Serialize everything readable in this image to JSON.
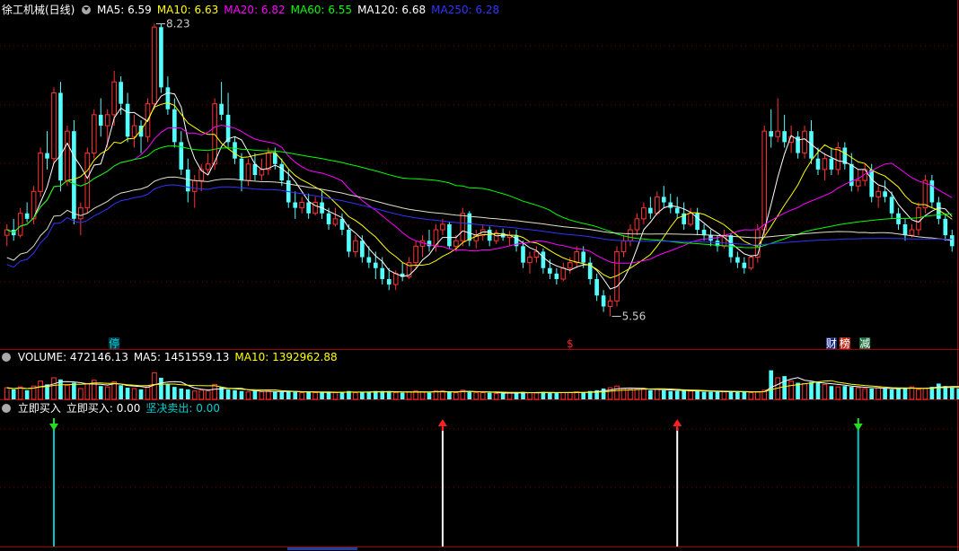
{
  "main_panel": {
    "title": "徐工机械(日线)",
    "ma_labels": [
      {
        "text": "MA5: 6.59",
        "color": "#ffffff"
      },
      {
        "text": "MA10: 6.63",
        "color": "#ffff00"
      },
      {
        "text": "MA20: 6.82",
        "color": "#ff00ff"
      },
      {
        "text": "MA60: 6.55",
        "color": "#00ff00"
      },
      {
        "text": "MA120: 6.68",
        "color": "#ffffff"
      },
      {
        "text": "MA250: 6.28",
        "color": "#3333ff"
      }
    ],
    "high_label": "8.23",
    "low_label": "5.56",
    "markers": [
      {
        "text": "停",
        "color": "#00d0d0",
        "bg": "#004050"
      },
      {
        "text": "$",
        "color": "#ff2020",
        "bg": "#000000"
      },
      {
        "text": "财",
        "color": "#ffffff",
        "bg": "#203080"
      },
      {
        "text": "榜",
        "color": "#ffffff",
        "bg": "#c03020"
      },
      {
        "text": "减",
        "color": "#ffffff",
        "bg": "#207040"
      }
    ]
  },
  "volume_panel": {
    "labels": [
      {
        "text": "VOLUME: 472146.13",
        "color": "#ffffff"
      },
      {
        "text": "MA5: 1451559.13",
        "color": "#ffffff"
      },
      {
        "text": "MA10: 1392962.88",
        "color": "#ffff00"
      }
    ]
  },
  "signal_panel": {
    "labels": [
      {
        "text": "立即买入",
        "color": "#ffffff"
      },
      {
        "text": "立即买入: 0.00",
        "color": "#ffffff"
      },
      {
        "text": "坚决卖出: 0.00",
        "color": "#00d0d0"
      }
    ]
  },
  "chart_data": [
    {
      "type": "candlestick",
      "title": "徐工机械(日线)",
      "ylim": [
        5.4,
        8.3
      ],
      "candles": [
        [
          6.3,
          6.4,
          6.2,
          6.35
        ],
        [
          6.35,
          6.45,
          6.25,
          6.3
        ],
        [
          6.3,
          6.55,
          6.28,
          6.5
        ],
        [
          6.5,
          6.6,
          6.42,
          6.45
        ],
        [
          6.45,
          6.75,
          6.4,
          6.7
        ],
        [
          6.7,
          7.1,
          6.65,
          7.05
        ],
        [
          7.05,
          7.25,
          6.9,
          7.0
        ],
        [
          7.0,
          7.65,
          6.95,
          7.6
        ],
        [
          7.6,
          7.7,
          6.7,
          6.8
        ],
        [
          6.8,
          7.3,
          6.75,
          7.25
        ],
        [
          7.25,
          7.35,
          6.4,
          6.45
        ],
        [
          6.45,
          6.6,
          6.3,
          6.55
        ],
        [
          6.55,
          7.1,
          6.5,
          7.05
        ],
        [
          7.05,
          7.45,
          7.0,
          7.4
        ],
        [
          7.4,
          7.55,
          7.2,
          7.3
        ],
        [
          7.3,
          7.45,
          7.1,
          7.4
        ],
        [
          7.4,
          7.8,
          7.3,
          7.7
        ],
        [
          7.7,
          7.75,
          7.4,
          7.5
        ],
        [
          7.5,
          7.6,
          7.15,
          7.2
        ],
        [
          7.2,
          7.4,
          7.1,
          7.3
        ],
        [
          7.3,
          7.35,
          7.05,
          7.2
        ],
        [
          7.2,
          7.55,
          7.15,
          7.5
        ],
        [
          7.5,
          8.23,
          7.45,
          8.2
        ],
        [
          8.2,
          8.23,
          7.6,
          7.65
        ],
        [
          7.65,
          7.75,
          7.4,
          7.45
        ],
        [
          7.45,
          7.55,
          7.1,
          7.15
        ],
        [
          7.15,
          7.25,
          6.85,
          6.9
        ],
        [
          6.9,
          7.0,
          6.6,
          6.7
        ],
        [
          6.7,
          6.85,
          6.55,
          6.8
        ],
        [
          6.8,
          6.95,
          6.7,
          6.9
        ],
        [
          6.9,
          7.05,
          6.85,
          6.95
        ],
        [
          6.95,
          7.55,
          6.9,
          7.5
        ],
        [
          7.5,
          7.7,
          7.35,
          7.4
        ],
        [
          7.4,
          7.6,
          7.1,
          7.15
        ],
        [
          7.15,
          7.2,
          6.95,
          7.0
        ],
        [
          7.0,
          7.05,
          6.7,
          6.8
        ],
        [
          6.8,
          7.0,
          6.75,
          6.95
        ],
        [
          6.95,
          7.05,
          6.8,
          6.85
        ],
        [
          6.85,
          7.0,
          6.8,
          6.9
        ],
        [
          6.9,
          7.1,
          6.85,
          7.05
        ],
        [
          7.05,
          7.1,
          6.9,
          6.95
        ],
        [
          6.95,
          7.0,
          6.75,
          6.8
        ],
        [
          6.8,
          6.9,
          6.55,
          6.6
        ],
        [
          6.6,
          6.7,
          6.45,
          6.55
        ],
        [
          6.55,
          6.65,
          6.5,
          6.6
        ],
        [
          6.6,
          6.68,
          6.45,
          6.5
        ],
        [
          6.5,
          6.65,
          6.48,
          6.6
        ],
        [
          6.6,
          6.7,
          6.45,
          6.5
        ],
        [
          6.5,
          6.55,
          6.35,
          6.4
        ],
        [
          6.4,
          6.55,
          6.38,
          6.45
        ],
        [
          6.45,
          6.5,
          6.3,
          6.35
        ],
        [
          6.35,
          6.4,
          6.1,
          6.15
        ],
        [
          6.15,
          6.3,
          6.1,
          6.25
        ],
        [
          6.25,
          6.3,
          6.05,
          6.1
        ],
        [
          6.1,
          6.2,
          6.0,
          6.05
        ],
        [
          6.05,
          6.15,
          5.9,
          6.0
        ],
        [
          6.0,
          6.1,
          5.85,
          5.9
        ],
        [
          5.9,
          6.0,
          5.8,
          5.85
        ],
        [
          5.85,
          5.98,
          5.8,
          5.95
        ],
        [
          5.95,
          6.05,
          5.88,
          5.92
        ],
        [
          5.92,
          6.1,
          5.9,
          6.05
        ],
        [
          6.05,
          6.25,
          6.0,
          6.2
        ],
        [
          6.2,
          6.3,
          6.1,
          6.25
        ],
        [
          6.25,
          6.35,
          6.15,
          6.2
        ],
        [
          6.2,
          6.4,
          6.15,
          6.35
        ],
        [
          6.35,
          6.45,
          6.3,
          6.4
        ],
        [
          6.4,
          6.42,
          6.18,
          6.2
        ],
        [
          6.2,
          6.3,
          6.15,
          6.25
        ],
        [
          6.25,
          6.55,
          6.2,
          6.5
        ],
        [
          6.5,
          6.52,
          6.2,
          6.25
        ],
        [
          6.25,
          6.35,
          6.18,
          6.3
        ],
        [
          6.3,
          6.4,
          6.25,
          6.35
        ],
        [
          6.35,
          6.38,
          6.2,
          6.25
        ],
        [
          6.25,
          6.35,
          6.22,
          6.32
        ],
        [
          6.32,
          6.36,
          6.25,
          6.28
        ],
        [
          6.28,
          6.34,
          6.2,
          6.3
        ],
        [
          6.3,
          6.35,
          6.15,
          6.2
        ],
        [
          6.2,
          6.25,
          6.0,
          6.05
        ],
        [
          6.05,
          6.15,
          5.95,
          6.1
        ],
        [
          6.1,
          6.2,
          6.05,
          6.15
        ],
        [
          6.15,
          6.18,
          5.95,
          6.0
        ],
        [
          6.0,
          6.08,
          5.9,
          5.95
        ],
        [
          5.95,
          6.0,
          5.85,
          5.9
        ],
        [
          5.9,
          6.05,
          5.88,
          6.0
        ],
        [
          6.0,
          6.1,
          5.95,
          6.05
        ],
        [
          6.05,
          6.2,
          6.0,
          6.15
        ],
        [
          6.15,
          6.2,
          6.0,
          6.05
        ],
        [
          6.05,
          6.1,
          5.85,
          5.9
        ],
        [
          5.9,
          5.95,
          5.7,
          5.75
        ],
        [
          5.75,
          5.8,
          5.6,
          5.65
        ],
        [
          5.65,
          5.75,
          5.56,
          5.7
        ],
        [
          5.7,
          6.2,
          5.65,
          6.15
        ],
        [
          6.15,
          6.3,
          6.1,
          6.25
        ],
        [
          6.25,
          6.4,
          6.2,
          6.35
        ],
        [
          6.35,
          6.5,
          6.3,
          6.45
        ],
        [
          6.45,
          6.6,
          6.4,
          6.55
        ],
        [
          6.55,
          6.65,
          6.45,
          6.5
        ],
        [
          6.5,
          6.7,
          6.48,
          6.65
        ],
        [
          6.65,
          6.75,
          6.55,
          6.6
        ],
        [
          6.6,
          6.68,
          6.5,
          6.55
        ],
        [
          6.55,
          6.65,
          6.45,
          6.5
        ],
        [
          6.5,
          6.6,
          6.35,
          6.4
        ],
        [
          6.4,
          6.55,
          6.38,
          6.5
        ],
        [
          6.5,
          6.55,
          6.3,
          6.35
        ],
        [
          6.35,
          6.4,
          6.25,
          6.3
        ],
        [
          6.3,
          6.35,
          6.2,
          6.25
        ],
        [
          6.25,
          6.3,
          6.15,
          6.2
        ],
        [
          6.2,
          6.35,
          6.18,
          6.3
        ],
        [
          6.3,
          6.32,
          6.05,
          6.1
        ],
        [
          6.1,
          6.15,
          6.0,
          6.05
        ],
        [
          6.05,
          6.1,
          5.95,
          6.0
        ],
        [
          6.0,
          6.12,
          5.98,
          6.1
        ],
        [
          6.1,
          6.4,
          6.05,
          6.35
        ],
        [
          6.35,
          7.3,
          6.3,
          7.25
        ],
        [
          7.25,
          7.45,
          7.1,
          7.2
        ],
        [
          7.2,
          7.55,
          7.15,
          7.25
        ],
        [
          7.25,
          7.4,
          7.1,
          7.15
        ],
        [
          7.15,
          7.3,
          7.05,
          7.2
        ],
        [
          7.2,
          7.25,
          7.0,
          7.05
        ],
        [
          7.05,
          7.3,
          7.0,
          7.25
        ],
        [
          7.25,
          7.35,
          6.95,
          7.0
        ],
        [
          7.0,
          7.1,
          6.85,
          6.9
        ],
        [
          6.9,
          7.05,
          6.8,
          7.0
        ],
        [
          7.0,
          7.1,
          6.85,
          6.9
        ],
        [
          6.9,
          7.15,
          6.85,
          7.1
        ],
        [
          7.1,
          7.15,
          6.9,
          6.95
        ],
        [
          6.95,
          7.05,
          6.7,
          6.75
        ],
        [
          6.75,
          6.9,
          6.7,
          6.8
        ],
        [
          6.8,
          6.95,
          6.75,
          6.9
        ],
        [
          6.9,
          6.95,
          6.6,
          6.65
        ],
        [
          6.65,
          6.75,
          6.55,
          6.7
        ],
        [
          6.7,
          6.8,
          6.6,
          6.65
        ],
        [
          6.65,
          6.7,
          6.45,
          6.5
        ],
        [
          6.5,
          6.55,
          6.35,
          6.4
        ],
        [
          6.4,
          6.45,
          6.25,
          6.3
        ],
        [
          6.3,
          6.4,
          6.28,
          6.35
        ],
        [
          6.35,
          6.6,
          6.3,
          6.55
        ],
        [
          6.55,
          6.85,
          6.5,
          6.8
        ],
        [
          6.8,
          6.85,
          6.55,
          6.6
        ],
        [
          6.6,
          6.65,
          6.4,
          6.45
        ],
        [
          6.45,
          6.5,
          6.25,
          6.3
        ],
        [
          6.3,
          6.35,
          6.15,
          6.2
        ]
      ]
    },
    {
      "type": "bar",
      "title": "VOLUME",
      "values": [
        1.4,
        1.2,
        1.5,
        1.1,
        1.6,
        2.2,
        1.8,
        2.6,
        2.4,
        1.7,
        2.0,
        1.3,
        1.9,
        2.3,
        1.6,
        1.5,
        2.1,
        1.7,
        1.4,
        1.3,
        1.2,
        1.6,
        3.2,
        2.6,
        1.8,
        1.5,
        1.3,
        1.2,
        1.0,
        1.1,
        1.0,
        1.8,
        1.5,
        1.2,
        1.1,
        1.0,
        0.9,
        1.0,
        0.9,
        1.0,
        0.9,
        0.9,
        1.0,
        0.9,
        0.8,
        0.9,
        0.8,
        0.8,
        0.9,
        0.8,
        0.9,
        1.0,
        0.8,
        0.9,
        0.9,
        1.0,
        1.0,
        0.9,
        0.8,
        0.8,
        0.9,
        1.0,
        0.9,
        0.8,
        1.0,
        1.0,
        0.9,
        0.8,
        1.1,
        1.0,
        0.8,
        0.8,
        0.8,
        0.7,
        0.7,
        0.8,
        0.8,
        0.9,
        0.8,
        0.8,
        0.9,
        0.8,
        0.8,
        0.8,
        0.8,
        0.9,
        0.8,
        1.0,
        1.1,
        1.3,
        1.4,
        1.6,
        1.3,
        1.2,
        1.2,
        1.3,
        1.1,
        1.2,
        1.1,
        1.0,
        1.0,
        1.1,
        1.0,
        1.0,
        0.9,
        0.9,
        0.9,
        0.9,
        1.0,
        0.9,
        0.9,
        0.8,
        0.9,
        1.1,
        3.5,
        2.6,
        2.8,
        2.2,
        2.0,
        1.9,
        2.1,
        2.0,
        1.8,
        1.6,
        1.5,
        1.6,
        1.5,
        1.4,
        1.3,
        1.3,
        1.4,
        1.3,
        1.2,
        1.3,
        1.4,
        1.5,
        1.2,
        1.3,
        1.5,
        1.9,
        1.6,
        1.4,
        1.3,
        1.2
      ],
      "ylim": [
        0,
        4
      ]
    },
    {
      "type": "signal",
      "title": "立即买入",
      "signals": [
        {
          "index": 7,
          "kind": "sell",
          "value": 1
        },
        {
          "index": 65,
          "kind": "buy",
          "value": 1
        },
        {
          "index": 100,
          "kind": "buy",
          "value": 1
        },
        {
          "index": 127,
          "kind": "sell",
          "value": 1
        }
      ]
    }
  ]
}
